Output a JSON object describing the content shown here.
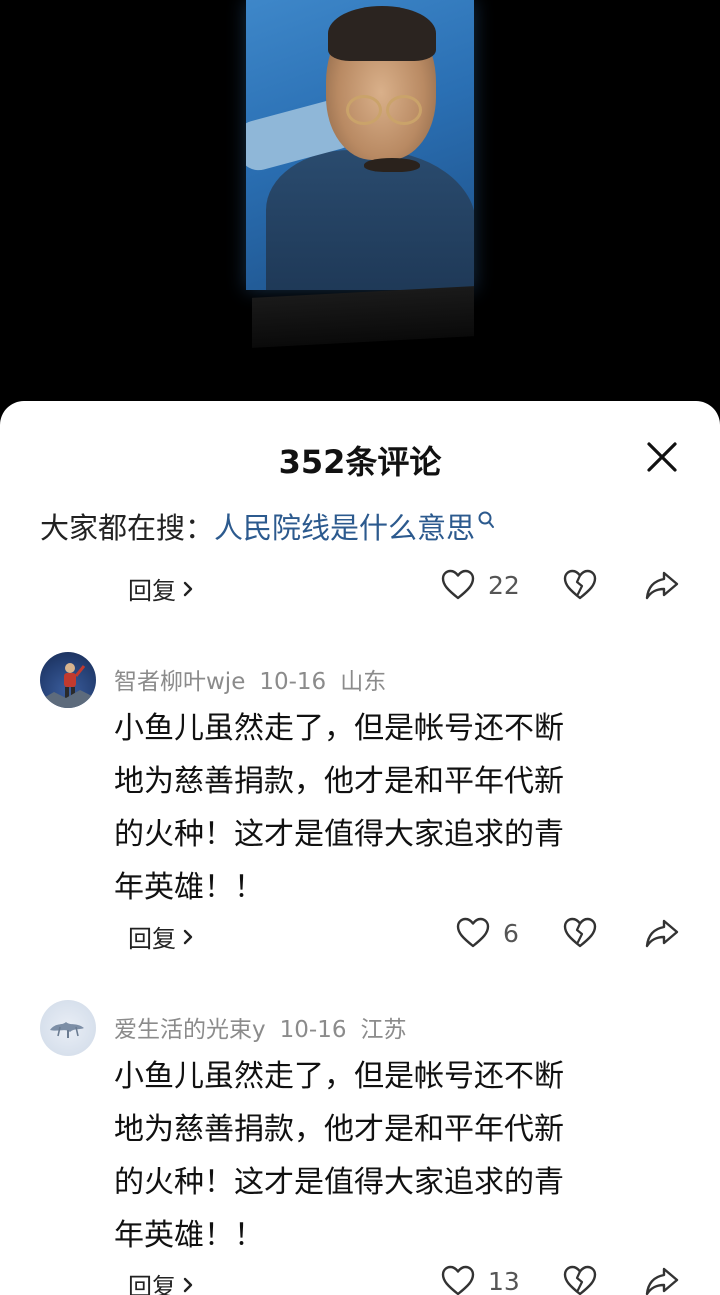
{
  "panel": {
    "title": "352条评论",
    "search_prefix": "大家都在搜：",
    "search_link": "人民院线是什么意思"
  },
  "top_actions": {
    "reply_label": "回复",
    "like_count": "22"
  },
  "comments": [
    {
      "username": "智者柳叶wje",
      "date": "10-16",
      "location": "山东",
      "lines": [
        "小鱼儿虽然走了，但是帐号还不断",
        "地为慈善捐款，他才是和平年代新",
        "的火种！这才是值得大家追求的青",
        "年英雄！！"
      ],
      "reply_label": "回复",
      "like_count": "6"
    },
    {
      "username": "爱生活的光束y",
      "date": "10-16",
      "location": "江苏",
      "lines": [
        "小鱼儿虽然走了，但是帐号还不断",
        "地为慈善捐款，他才是和平年代新",
        "的火种！这才是值得大家追求的青",
        "年英雄！！"
      ],
      "reply_label": "回复",
      "like_count": "13"
    }
  ],
  "icons": {
    "close": "close-icon",
    "search": "search-icon",
    "like": "heart-icon",
    "dislike": "broken-heart-icon",
    "share": "share-icon",
    "reply": "chevron-right-icon"
  },
  "colors": {
    "link": "#2c5a8e",
    "meta": "#8b8b8b",
    "background_top": "#000000",
    "panel": "#ffffff"
  }
}
